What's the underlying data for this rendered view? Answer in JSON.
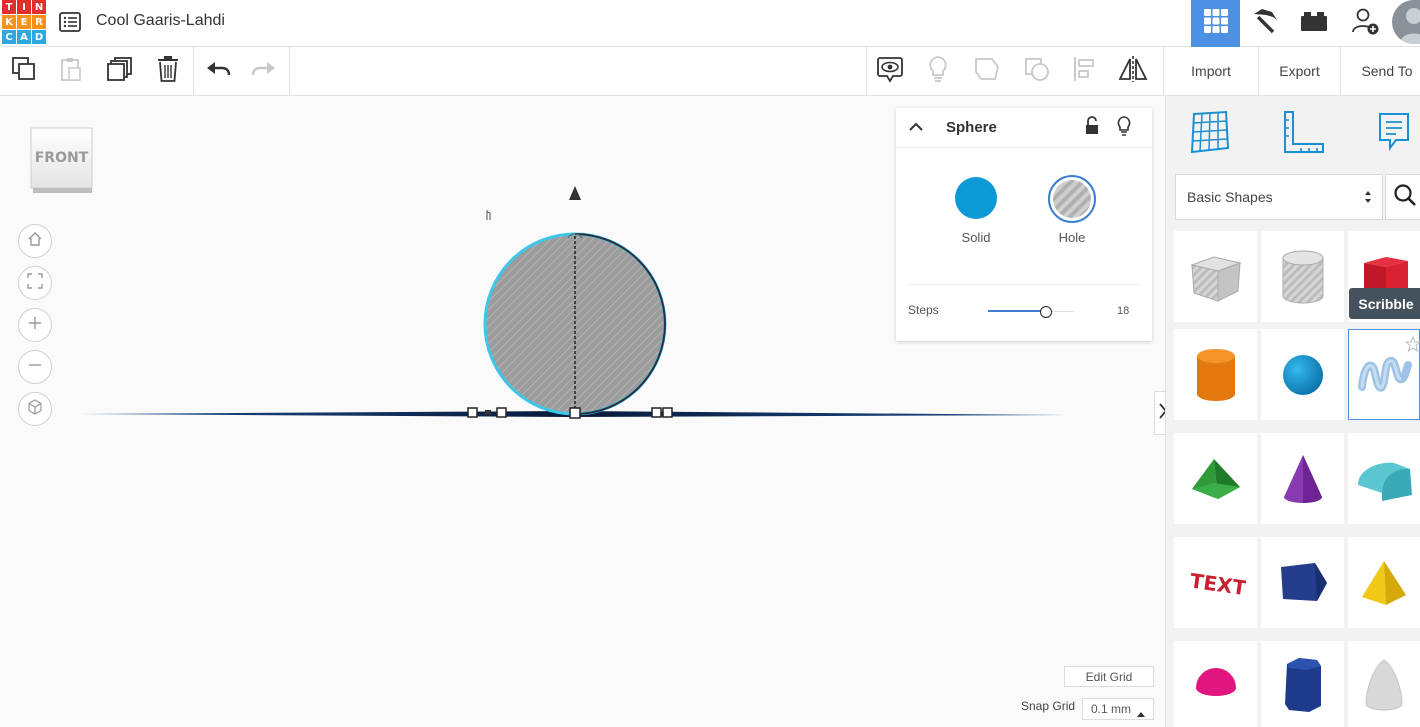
{
  "header": {
    "logo_letters": [
      "T",
      "I",
      "N",
      "K",
      "E",
      "R",
      "C",
      "A",
      "D"
    ],
    "logo_colors": [
      "#e1302b",
      "#e1302b",
      "#e1302b",
      "#f7931d",
      "#f7931d",
      "#f7931d",
      "#2fa8e0",
      "#2fa8e0",
      "#2fa8e0"
    ],
    "title": "Cool Gaaris-Lahdi",
    "active_color": "#4d8fe0"
  },
  "toolbar": {
    "import_label": "Import",
    "export_label": "Export",
    "send_to_label": "Send To"
  },
  "viewcube": {
    "label": "FRONT"
  },
  "inspector": {
    "title": "Sphere",
    "solid_label": "Solid",
    "hole_label": "Hole",
    "steps_label": "Steps",
    "steps_value": "18",
    "steps_fraction": 0.7,
    "solid_color": "#0b9ad6"
  },
  "sidepanel": {
    "category": "Basic Shapes",
    "tooltip": "Scribble"
  },
  "grid": {
    "edit_label": "Edit Grid",
    "snap_label": "Snap Grid",
    "snap_value": "0.1 mm"
  }
}
